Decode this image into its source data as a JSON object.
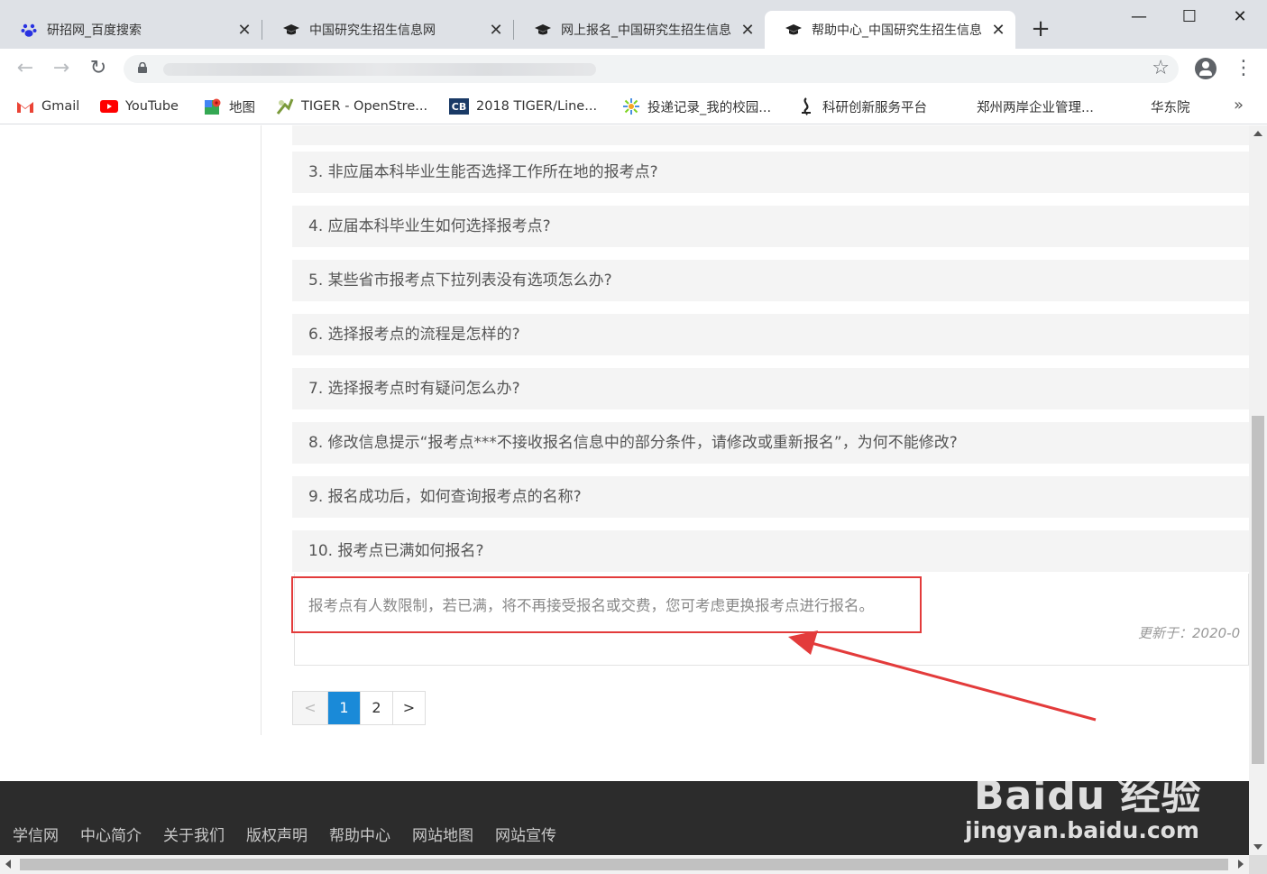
{
  "browser": {
    "tabs": [
      {
        "title": "研招网_百度搜索",
        "icon": "baidu-paw-icon",
        "active": false
      },
      {
        "title": "中国研究生招生信息网",
        "icon": "mortarboard-icon",
        "active": false
      },
      {
        "title": "网上报名_中国研究生招生信息",
        "icon": "mortarboard-icon",
        "active": false
      },
      {
        "title": "帮助中心_中国研究生招生信息",
        "icon": "mortarboard-icon",
        "active": true
      }
    ],
    "close_glyph": "✕",
    "new_tab_glyph": "+",
    "window_controls": {
      "minimize": "—",
      "maximize": "☐",
      "close": "✕"
    },
    "nav": {
      "back": "←",
      "forward": "→",
      "reload": "↻"
    },
    "star_glyph": "☆",
    "menu_glyph": "⋮",
    "bookmarks": [
      {
        "label": "Gmail",
        "icon": "gmail-icon"
      },
      {
        "label": "YouTube",
        "icon": "youtube-icon"
      },
      {
        "label": "地图",
        "icon": "maps-icon"
      },
      {
        "label": "TIGER - OpenStre...",
        "icon": "tiger-icon"
      },
      {
        "label": "2018 TIGER/Line...",
        "icon": "census-cb-icon"
      },
      {
        "label": "投递记录_我的校园...",
        "icon": "campus-icon"
      },
      {
        "label": "科研创新服务平台",
        "icon": "research-icon"
      },
      {
        "label": "郑州两岸企业管理...",
        "icon": ""
      },
      {
        "label": "华东院",
        "icon": ""
      }
    ],
    "bookmarks_more": "»"
  },
  "faq": {
    "items": [
      "3. 非应届本科毕业生能否选择工作所在地的报考点?",
      "4. 应届本科毕业生如何选择报考点?",
      "5. 某些省市报考点下拉列表没有选项怎么办?",
      "6. 选择报考点的流程是怎样的?",
      "7. 选择报考点时有疑问怎么办?",
      "8. 修改信息提示“报考点***不接收报名信息中的部分条件，请修改或重新报名”，为何不能修改?",
      "9. 报名成功后，如何查询报考点的名称?",
      "10. 报考点已满如何报名?"
    ],
    "answer": "报考点有人数限制，若已满，将不再接受报名或交费，您可考虑更换报考点进行报名。",
    "updated": "更新于：2020-0"
  },
  "pagination": {
    "prev": "<",
    "pages": [
      "1",
      "2"
    ],
    "current": "1",
    "next": ">"
  },
  "footer": {
    "links": [
      "学信网",
      "中心简介",
      "关于我们",
      "版权声明",
      "帮助中心",
      "网站地图",
      "网站宣传"
    ]
  },
  "watermark": {
    "logo": "Baidu 经验",
    "url": "jingyan.baidu.com"
  },
  "colors": {
    "accent_blue": "#1a8ad8",
    "highlight_red": "#e33b3b",
    "footer_bg": "#2c2c2c",
    "faq_bg": "#f4f4f4"
  }
}
